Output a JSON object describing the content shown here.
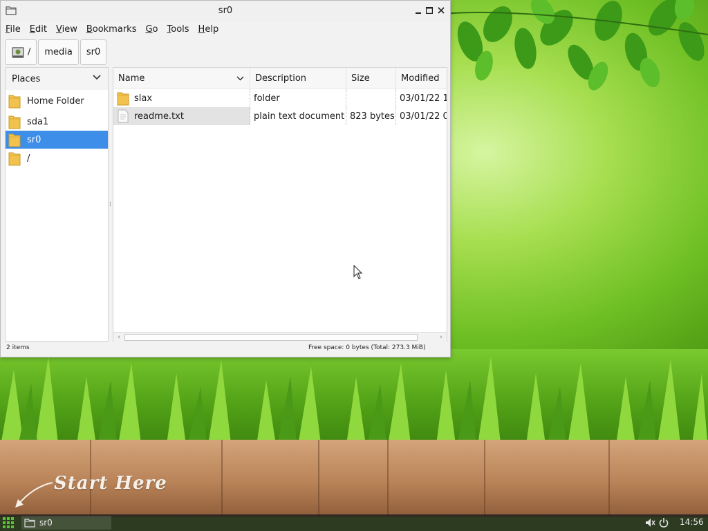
{
  "window": {
    "title": "sr0",
    "menu": [
      "File",
      "Edit",
      "View",
      "Bookmarks",
      "Go",
      "Tools",
      "Help"
    ],
    "menu_underline": [
      "F",
      "E",
      "V",
      "B",
      "G",
      "T",
      "H"
    ]
  },
  "pathbar": {
    "root_label": "/",
    "crumbs": [
      "media",
      "sr0"
    ]
  },
  "places": {
    "header": "Places",
    "items": [
      {
        "label": "Home Folder",
        "icon": "folder-icon"
      },
      {
        "label": "sda1",
        "icon": "folder-icon"
      },
      {
        "label": "sr0",
        "icon": "folder-icon",
        "selected": true
      },
      {
        "label": "/",
        "icon": "folder-icon"
      }
    ]
  },
  "files": {
    "columns": [
      "Name",
      "Description",
      "Size",
      "Modified"
    ],
    "rows": [
      {
        "name": "slax",
        "description": "folder",
        "size": "",
        "modified": "03/01/22 1",
        "icon": "folder-icon"
      },
      {
        "name": "readme.txt",
        "description": "plain text document",
        "size": "823 bytes",
        "modified": "03/01/22 0",
        "icon": "text-file-icon"
      }
    ]
  },
  "status": {
    "items": "2 items",
    "free_space": "Free space: 0 bytes (Total: 273.3 MiB)"
  },
  "desktop": {
    "start_here": "Start Here"
  },
  "taskbar": {
    "task_label": "sr0",
    "clock": "14:56"
  },
  "colors": {
    "selection": "#3d8ee8",
    "folder": "#f2c24e",
    "taskbar": "#1e1e1e"
  }
}
